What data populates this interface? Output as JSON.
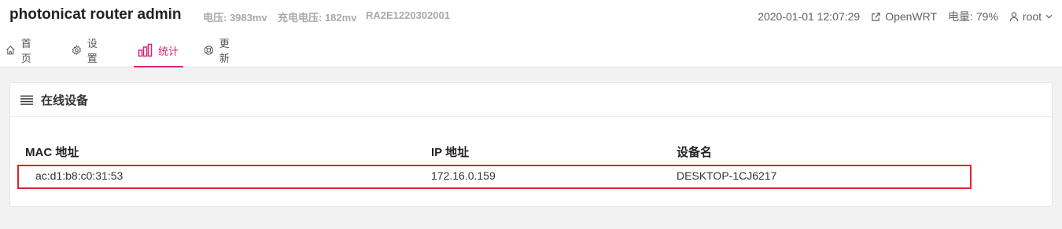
{
  "header": {
    "title": "photonicat router admin",
    "voltage": "电压: 3983mv",
    "charge_voltage": "充电电压: 182mv",
    "serial": "RA2E1220302001",
    "datetime": "2020-01-01 12:07:29",
    "openwrt_link": "OpenWRT",
    "battery": "电量: 79%",
    "user": "root",
    "icons": [
      "external-link-icon",
      "user-icon",
      "chevron-down-icon"
    ]
  },
  "nav": {
    "items": [
      {
        "label": "首页",
        "icon": "home-icon"
      },
      {
        "label": "设置",
        "icon": "gear-icon"
      },
      {
        "label": "统计",
        "icon": "bar-chart-icon",
        "active": true
      },
      {
        "label": "更新",
        "icon": "lifebuoy-icon"
      }
    ],
    "accent_color": "#d6247a"
  },
  "card": {
    "title": "在线设备",
    "icon": "list-icon",
    "table": {
      "headers": [
        "MAC 地址",
        "IP 地址",
        "设备名"
      ],
      "rows": [
        [
          "ac:d1:b8:c0:31:53",
          "172.16.0.159",
          "DESKTOP-1CJ6217"
        ]
      ]
    },
    "highlight_color": "#e0242d"
  }
}
